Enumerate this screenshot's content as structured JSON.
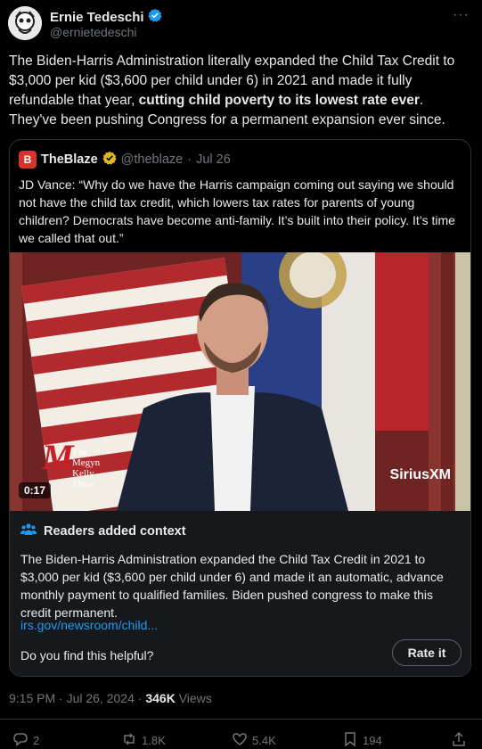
{
  "author": {
    "display_name": "Ernie Tedeschi",
    "handle": "@ernietedeschi",
    "verified": true
  },
  "more_label": "···",
  "tweet": {
    "text_part1": "The Biden-Harris Administration literally expanded the Child Tax Credit to $3,000 per kid ($3,600 per child under 6) in 2021 and made it fully refundable that year, ",
    "text_bold": "cutting child poverty to its lowest rate ever",
    "text_part2": ". They've been pushing Congress for a permanent expansion ever since."
  },
  "quote": {
    "logo_letter": "B",
    "display_name": "TheBlaze",
    "handle": "@theblaze",
    "separator": "·",
    "date": "Jul 26",
    "text": "JD Vance: “Why do we have the Harris campaign coming out saying we should not have the child tax credit, which lowers tax rates for parents of young children? Democrats have become anti-family. It’s built into their policy. It’s time we called that out.”",
    "video": {
      "timestamp": "0:17",
      "show_logo_line1": "The",
      "show_logo_line2": "Megyn",
      "show_logo_line3": "Kelly",
      "show_logo_line4": "Show",
      "show_logo_m": "M",
      "watermark": "SiriusXM"
    },
    "context": {
      "title": "Readers added context",
      "text": "The Biden-Harris Administration expanded the Child Tax Credit in 2021 to $3,000 per kid ($3,600 per child under 6) and made it an automatic, advance monthly payment to qualified families. Biden pushed congress to make this credit permanent.",
      "link": "irs.gov/newsroom/child...",
      "helpful_question": "Do you find this helpful?",
      "rate_button": "Rate it"
    }
  },
  "meta": {
    "time": "9:15 PM",
    "separator": "·",
    "date": "Jul 26, 2024",
    "separator2": "·",
    "views_count": "346K",
    "views_label": "Views"
  },
  "actions": {
    "replies": "2",
    "reposts": "1.8K",
    "likes": "5.4K",
    "bookmarks": "194"
  },
  "colors": {
    "accent": "#1d9bf0",
    "verified_gold": "#e2b719",
    "blaze_red": "#d6342c",
    "background": "#000000"
  }
}
